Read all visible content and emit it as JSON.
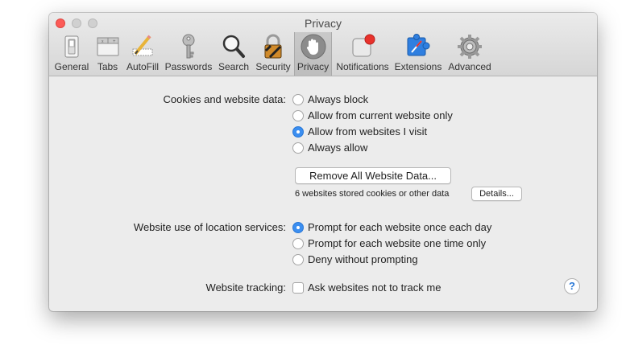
{
  "window": {
    "title": "Privacy"
  },
  "toolbar": {
    "items": [
      {
        "label": "General",
        "icon": "general-switch-icon"
      },
      {
        "label": "Tabs",
        "icon": "tabs-icon"
      },
      {
        "label": "AutoFill",
        "icon": "autofill-pencil-icon"
      },
      {
        "label": "Passwords",
        "icon": "key-icon"
      },
      {
        "label": "Search",
        "icon": "magnifier-icon"
      },
      {
        "label": "Security",
        "icon": "padlock-icon"
      },
      {
        "label": "Privacy",
        "icon": "hand-icon",
        "selected": true
      },
      {
        "label": "Notifications",
        "icon": "notification-badge-icon"
      },
      {
        "label": "Extensions",
        "icon": "extensions-puzzle-icon"
      },
      {
        "label": "Advanced",
        "icon": "gear-icon"
      }
    ]
  },
  "cookies": {
    "label": "Cookies and website data:",
    "options": [
      {
        "label": "Always block",
        "selected": false
      },
      {
        "label": "Allow from current website only",
        "selected": false
      },
      {
        "label": "Allow from websites I visit",
        "selected": true
      },
      {
        "label": "Always allow",
        "selected": false
      }
    ],
    "remove_button": "Remove All Website Data...",
    "stored_text": "6 websites stored cookies or other data",
    "details_button": "Details..."
  },
  "location": {
    "label": "Website use of location services:",
    "options": [
      {
        "label": "Prompt for each website once each day",
        "selected": true
      },
      {
        "label": "Prompt for each website one time only",
        "selected": false
      },
      {
        "label": "Deny without prompting",
        "selected": false
      }
    ]
  },
  "tracking": {
    "label": "Website tracking:",
    "checkbox_label": "Ask websites not to track me",
    "checked": false
  },
  "help": {
    "label": "?"
  },
  "colors": {
    "accent": "#3b8ef0",
    "close": "#fc5b57",
    "notification_badge": "#e8322c"
  }
}
